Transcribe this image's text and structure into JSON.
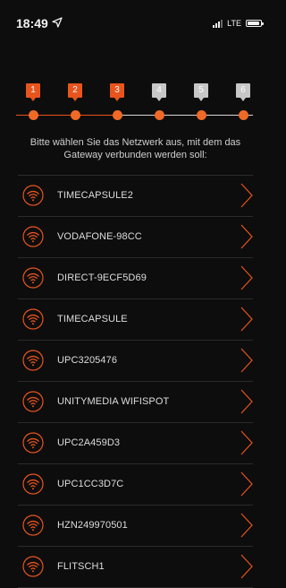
{
  "status_bar": {
    "time": "18:49",
    "network": "LTE",
    "location_icon": "location-arrow-icon",
    "signal_icon": "signal-bars-icon",
    "battery_icon": "battery-icon"
  },
  "colors": {
    "accent": "#e8541d",
    "inactive": "#c7c7c7",
    "background": "#0d0d0d"
  },
  "stepper": {
    "steps": [
      {
        "label": "1",
        "state": "active"
      },
      {
        "label": "2",
        "state": "active"
      },
      {
        "label": "3",
        "state": "active"
      },
      {
        "label": "4",
        "state": "inactive"
      },
      {
        "label": "5",
        "state": "inactive"
      },
      {
        "label": "6",
        "state": "inactive"
      }
    ]
  },
  "instruction": "Bitte wählen Sie das Netzwerk aus, mit dem das Gateway verbunden werden soll:",
  "networks": [
    {
      "ssid": "TIMECAPSULE2",
      "icon": "wifi-icon"
    },
    {
      "ssid": "VODAFONE-98CC",
      "icon": "wifi-icon"
    },
    {
      "ssid": "DIRECT-9ECF5D69",
      "icon": "wifi-icon"
    },
    {
      "ssid": "TIMECAPSULE",
      "icon": "wifi-icon"
    },
    {
      "ssid": "UPC3205476",
      "icon": "wifi-icon"
    },
    {
      "ssid": "UNITYMEDIA WIFISPOT",
      "icon": "wifi-icon"
    },
    {
      "ssid": "UPC2A459D3",
      "icon": "wifi-icon"
    },
    {
      "ssid": "UPC1CC3D7C",
      "icon": "wifi-icon"
    },
    {
      "ssid": "HZN249970501",
      "icon": "wifi-icon"
    },
    {
      "ssid": "FLITSCH1",
      "icon": "wifi-icon"
    }
  ]
}
